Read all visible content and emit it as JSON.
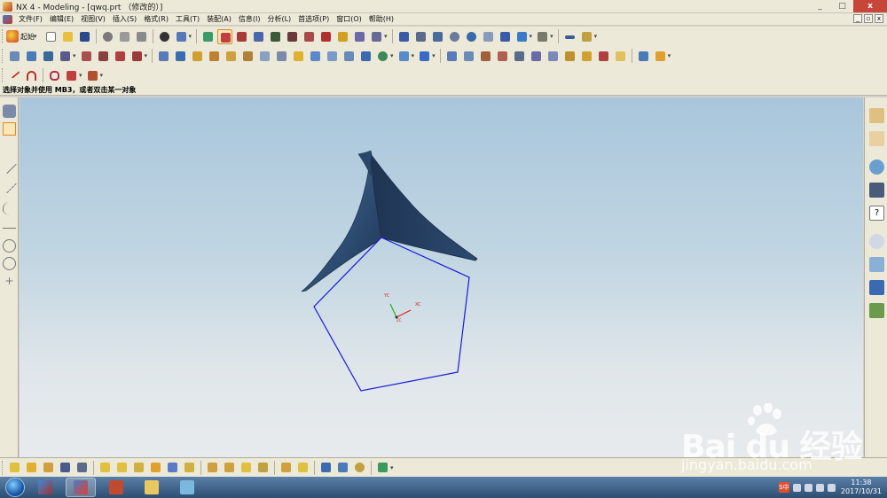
{
  "window": {
    "title": "NX 4 - Modeling - [qwq.prt （修改的）]",
    "controls": [
      "_",
      "□",
      "x"
    ]
  },
  "menu": {
    "items": [
      "文件(F)",
      "编辑(E)",
      "视图(V)",
      "插入(S)",
      "格式(R)",
      "工具(T)",
      "装配(A)",
      "信息(I)",
      "分析(L)",
      "首选项(P)",
      "窗口(O)",
      "帮助(H)"
    ],
    "mdi_controls": [
      "_",
      "▫",
      "x"
    ]
  },
  "toolbar": {
    "start_label": "起始"
  },
  "status": {
    "prompt": "选择对象并使用 MB3，或者双击某一对象"
  },
  "viewport": {
    "background_top": "#a8c6dc",
    "background_bottom": "#e8ebed",
    "csys_labels": {
      "x": "XC",
      "y": "YC",
      "z": "ZC"
    },
    "colors": {
      "surface": "#3d5f85",
      "sketch": "#1a1ad8",
      "xc": "#e02020",
      "yc": "#20b020"
    }
  },
  "taskbar": {
    "time": "11:38",
    "date": "2017/10/31",
    "ime": "S中"
  },
  "watermark": {
    "logo": "Bai du 经验",
    "url": "jingyan.baidu.com"
  }
}
